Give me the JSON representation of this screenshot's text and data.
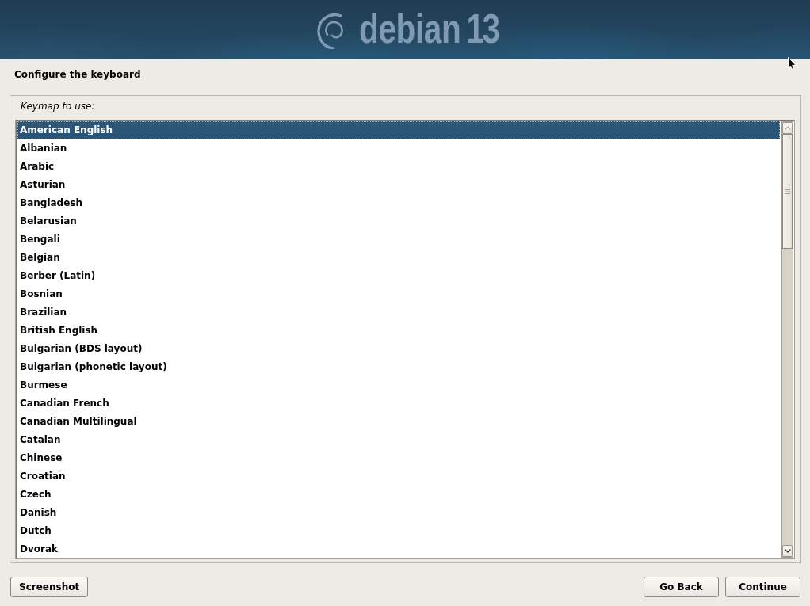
{
  "banner": {
    "logo_text": "debian",
    "version": "13"
  },
  "title": "Configure the keyboard",
  "keymap": {
    "label": "Keymap to use:",
    "items": [
      {
        "label": "American English",
        "selected": true
      },
      {
        "label": "Albanian",
        "selected": false
      },
      {
        "label": "Arabic",
        "selected": false
      },
      {
        "label": "Asturian",
        "selected": false
      },
      {
        "label": "Bangladesh",
        "selected": false
      },
      {
        "label": "Belarusian",
        "selected": false
      },
      {
        "label": "Bengali",
        "selected": false
      },
      {
        "label": "Belgian",
        "selected": false
      },
      {
        "label": "Berber (Latin)",
        "selected": false
      },
      {
        "label": "Bosnian",
        "selected": false
      },
      {
        "label": "Brazilian",
        "selected": false
      },
      {
        "label": "British English",
        "selected": false
      },
      {
        "label": "Bulgarian (BDS layout)",
        "selected": false
      },
      {
        "label": "Bulgarian (phonetic layout)",
        "selected": false
      },
      {
        "label": "Burmese",
        "selected": false
      },
      {
        "label": "Canadian French",
        "selected": false
      },
      {
        "label": "Canadian Multilingual",
        "selected": false
      },
      {
        "label": "Catalan",
        "selected": false
      },
      {
        "label": "Chinese",
        "selected": false
      },
      {
        "label": "Croatian",
        "selected": false
      },
      {
        "label": "Czech",
        "selected": false
      },
      {
        "label": "Danish",
        "selected": false
      },
      {
        "label": "Dutch",
        "selected": false
      },
      {
        "label": "Dvorak",
        "selected": false
      }
    ]
  },
  "footer": {
    "left_buttons": [
      "Screenshot"
    ],
    "right_buttons": [
      "Go Back",
      "Continue"
    ]
  }
}
